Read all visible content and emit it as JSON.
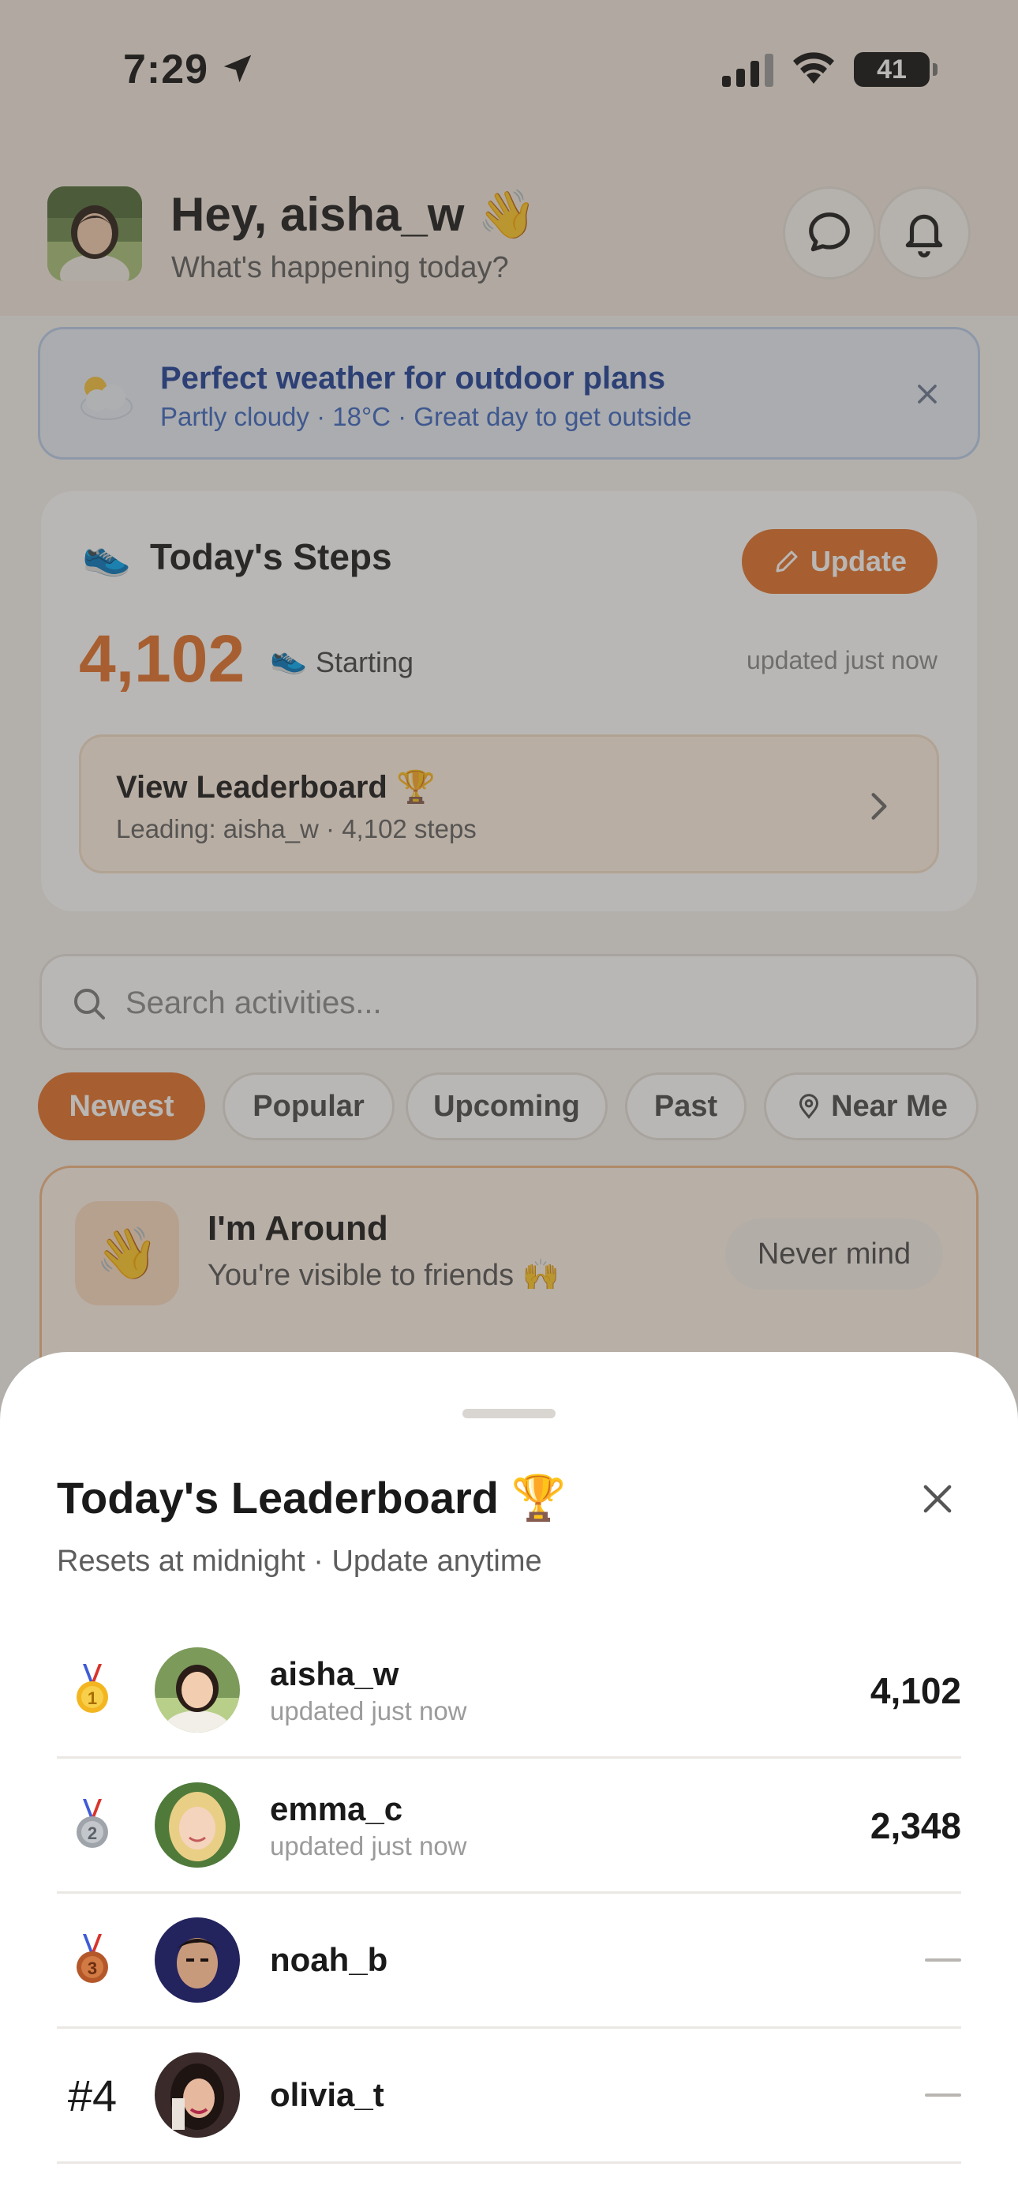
{
  "status_bar": {
    "time": "7:29",
    "battery": "41"
  },
  "header": {
    "greeting": "Hey, aisha_w 👋",
    "subtitle": "What's happening today?"
  },
  "weather_banner": {
    "title": "Perfect weather for outdoor plans",
    "subtitle": "Partly cloudy · 18°C · Great day to get outside"
  },
  "steps_card": {
    "title": "Today's Steps",
    "update_label": "Update",
    "count": "4,102",
    "status": "Starting",
    "updated": "updated just now",
    "leaderboard_link": {
      "title": "View Leaderboard 🏆",
      "subtitle": "Leading: aisha_w · 4,102 steps"
    }
  },
  "search": {
    "placeholder": "Search activities..."
  },
  "filters": [
    "Newest",
    "Popular",
    "Upcoming",
    "Past",
    "Near Me"
  ],
  "active_filter": "Newest",
  "around_card": {
    "title": "I'm Around",
    "subtitle": "You're visible to friends 🙌",
    "dismiss_label": "Never mind"
  },
  "leaderboard_sheet": {
    "title": "Today's Leaderboard 🏆",
    "subtitle": "Resets at midnight · Update anytime",
    "rows": [
      {
        "rank": "1",
        "username": "aisha_w",
        "sub": "updated just now",
        "score": "4,102"
      },
      {
        "rank": "2",
        "username": "emma_c",
        "sub": "updated just now",
        "score": "2,348"
      },
      {
        "rank": "3",
        "username": "noah_b",
        "sub": "",
        "score": ""
      },
      {
        "rank": "#4",
        "username": "olivia_t",
        "sub": "",
        "score": ""
      }
    ]
  },
  "colors": {
    "accent": "#e2722a",
    "weather_title": "#1d3f98",
    "weather_sub": "#3b67c2"
  },
  "icons": [
    "location-arrow-icon",
    "signal-icon",
    "wifi-icon",
    "battery-icon",
    "chat-bubble-icon",
    "bell-icon",
    "cloud-sun-icon",
    "close-icon",
    "shoe-icon",
    "pencil-icon",
    "chevron-right-icon",
    "search-icon",
    "map-pin-icon",
    "waving-hand-icon",
    "gold-medal-icon",
    "silver-medal-icon",
    "bronze-medal-icon"
  ]
}
